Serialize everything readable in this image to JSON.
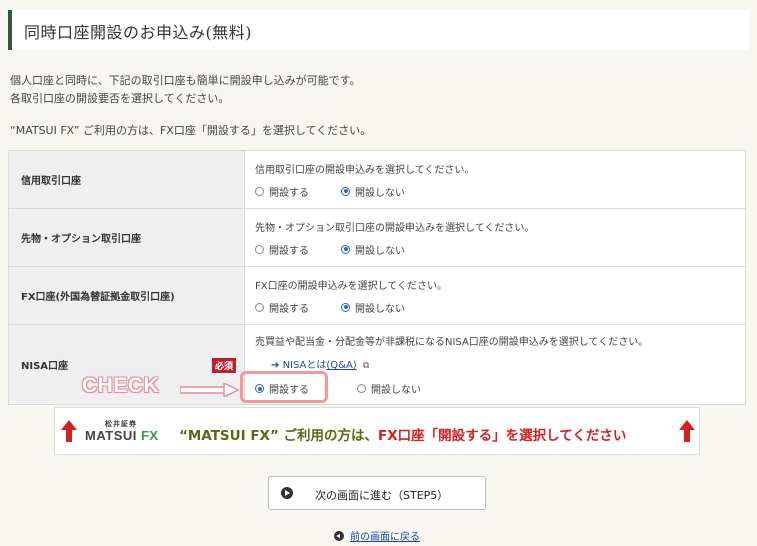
{
  "page_title": "同時口座開設のお申込み(無料)",
  "intro": [
    "個人口座と同時に、下記の取引口座も簡単に開設申し込みが可能です。",
    "各取引口座の開設要否を選択してください。"
  ],
  "notice": "“MATSUI FX” ご利用の方は、FX口座「開設する」を選択してください。",
  "accounts": [
    {
      "label": "信用取引口座",
      "desc": "信用取引口座の開設申込みを選択してください。",
      "opt_open": "開設する",
      "opt_no": "開設しない",
      "selected": "開設しない"
    },
    {
      "label": "先物・オプション取引口座",
      "desc": "先物・オプション取引口座の開設申込みを選択してください。",
      "opt_open": "開設する",
      "opt_no": "開設しない",
      "selected": "開設しない"
    },
    {
      "label": "FX口座(外国為替証拠金取引口座)",
      "desc": "FX口座の開設申込みを選択してください。",
      "opt_open": "開設する",
      "opt_no": "開設しない",
      "selected": "開設しない"
    },
    {
      "label": "NISA口座",
      "required": "必須",
      "desc": "売買益や配当金・分配金等が非課税になるNISA口座の開設申込みを選択してください。",
      "link_prefix": "NISAとは",
      "link_text": "(Q&A)",
      "opt_open": "開設する",
      "opt_no": "開設しない",
      "selected": "開設する"
    }
  ],
  "annotation": {
    "check_label": "CHECK",
    "highlight_color": "#f29a9a"
  },
  "banner": {
    "logo_small": "松井証券",
    "logo_main": "MATSUI ",
    "logo_fx": "FX",
    "text_part1": "“MATSUI FX” ご利用の方は、",
    "text_part2": "FX口座「開設する」を選択してください"
  },
  "next_button": "次の画面に進む（STEP5）",
  "back_link": "前の画面に戻る",
  "colors": {
    "accent_green": "#2f5a3b",
    "radio_blue": "#2367c9",
    "required_red": "#b8202c",
    "banner_red": "#d42020"
  }
}
